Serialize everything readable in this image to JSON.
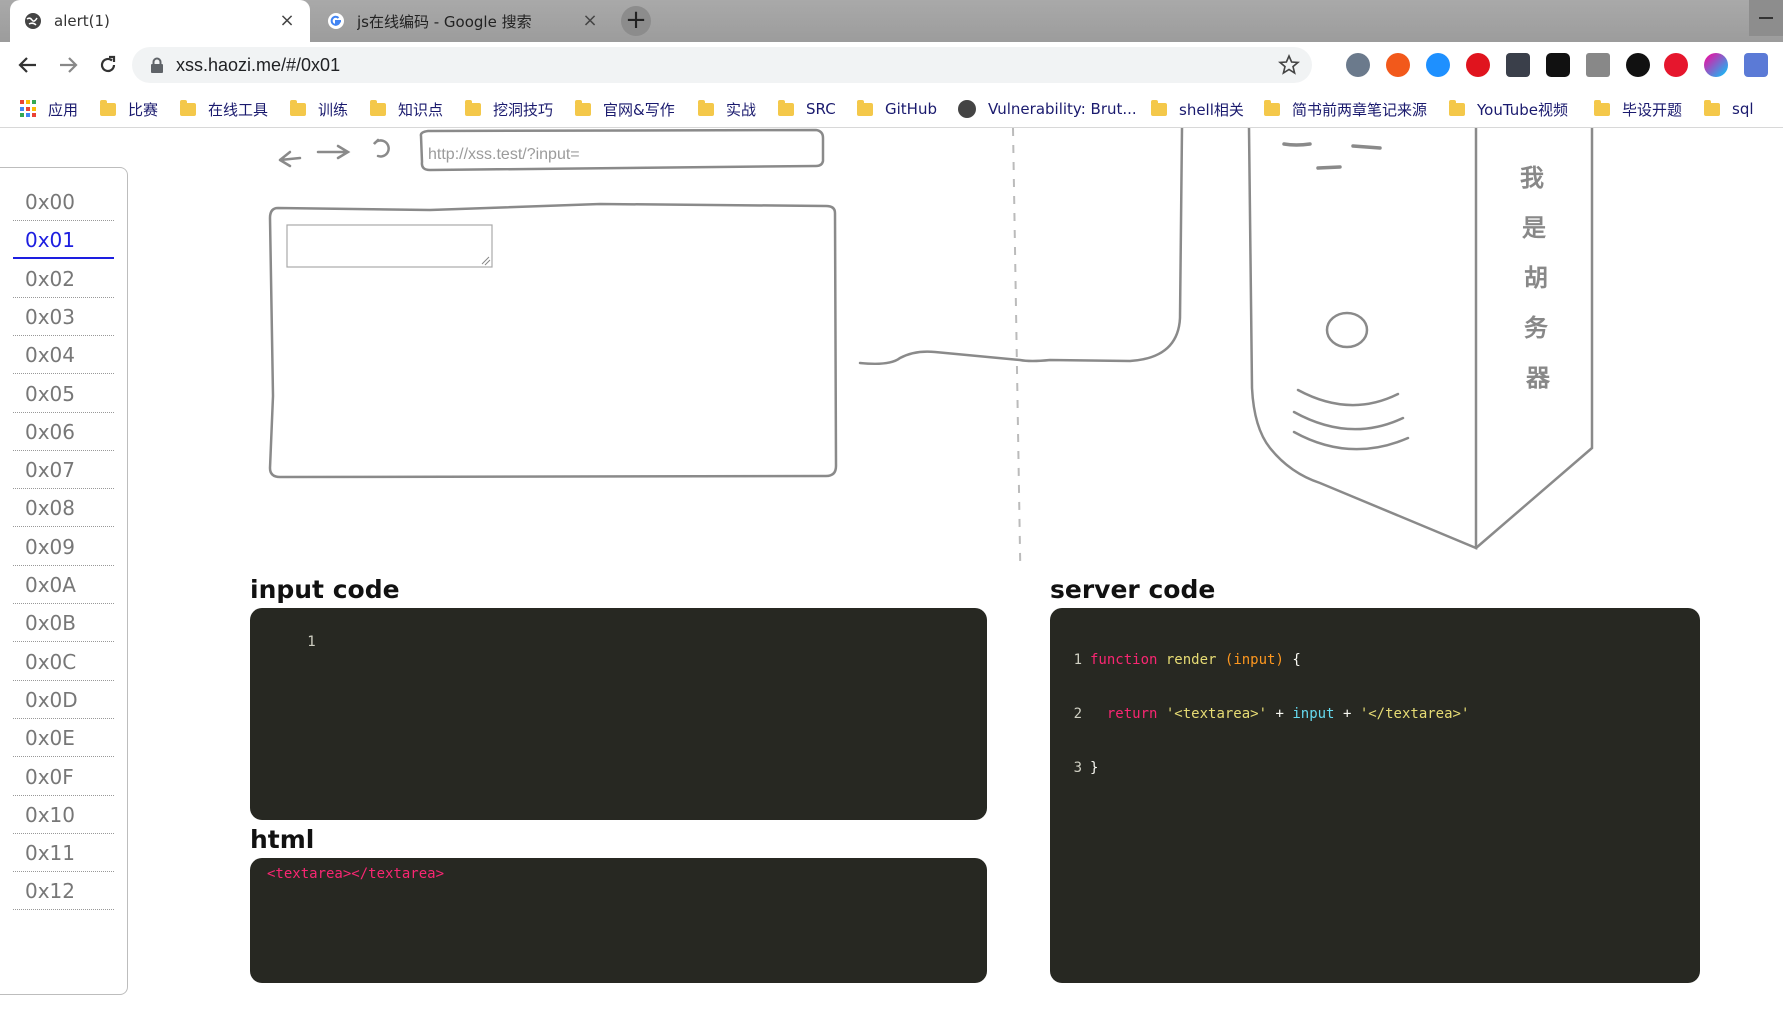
{
  "tabs": [
    {
      "title": "alert(1)",
      "close": "×",
      "active": true
    },
    {
      "title": "js在线编码 - Google 搜索",
      "close": "×",
      "active": false
    }
  ],
  "new_tab": "+",
  "address_bar": {
    "url": "xss.haozi.me/#/0x01"
  },
  "bookmarks": [
    {
      "label": "应用",
      "icon": "apps-grid-icon"
    },
    {
      "label": "比赛",
      "icon": "folder-icon"
    },
    {
      "label": "在线工具",
      "icon": "folder-icon"
    },
    {
      "label": "训练",
      "icon": "folder-icon"
    },
    {
      "label": "知识点",
      "icon": "folder-icon"
    },
    {
      "label": "挖洞技巧",
      "icon": "folder-icon"
    },
    {
      "label": "官网&写作",
      "icon": "folder-icon"
    },
    {
      "label": "实战",
      "icon": "folder-icon"
    },
    {
      "label": "SRC",
      "icon": "folder-icon"
    },
    {
      "label": "GitHub",
      "icon": "folder-icon"
    },
    {
      "label": "Vulnerability: Brut...",
      "icon": "globe-icon"
    },
    {
      "label": "shell相关",
      "icon": "folder-icon"
    },
    {
      "label": "简书前两章笔记来源",
      "icon": "folder-icon"
    },
    {
      "label": "YouTube视频",
      "icon": "folder-icon"
    },
    {
      "label": "毕设开题",
      "icon": "folder-icon"
    },
    {
      "label": "sql",
      "icon": "folder-icon"
    }
  ],
  "levels": [
    "0x00",
    "0x01",
    "0x02",
    "0x03",
    "0x04",
    "0x05",
    "0x06",
    "0x07",
    "0x08",
    "0x09",
    "0x0A",
    "0x0B",
    "0x0C",
    "0x0D",
    "0x0E",
    "0x0F",
    "0x10",
    "0x11",
    "0x12"
  ],
  "active_level": "0x01",
  "sketch": {
    "browser_url_placeholder": "http://xss.test/?input=",
    "server_label_chars": [
      "我",
      "是",
      "胡",
      "务",
      "器"
    ]
  },
  "input_code": {
    "title": "input code",
    "line_numbers": [
      "1"
    ]
  },
  "html_panel": {
    "title": "html",
    "content": "<textarea></textarea>"
  },
  "server_code": {
    "title": "server code",
    "line_numbers": [
      "1",
      "2",
      "3"
    ],
    "line1": {
      "kw": "function",
      "name": "render",
      "params": "(input)",
      "brace": "{"
    },
    "line2": {
      "kw": "return",
      "s1": "'<textarea>'",
      "plus1": "+",
      "var": "input",
      "plus2": "+",
      "s2": "'</textarea>'"
    },
    "line3": {
      "brace": "}"
    }
  },
  "colors": {
    "editor_bg": "#272822",
    "active_level": "#1d1ee0",
    "keyword": "#f92672",
    "string": "#e6db74",
    "variable": "#66d9ef"
  }
}
